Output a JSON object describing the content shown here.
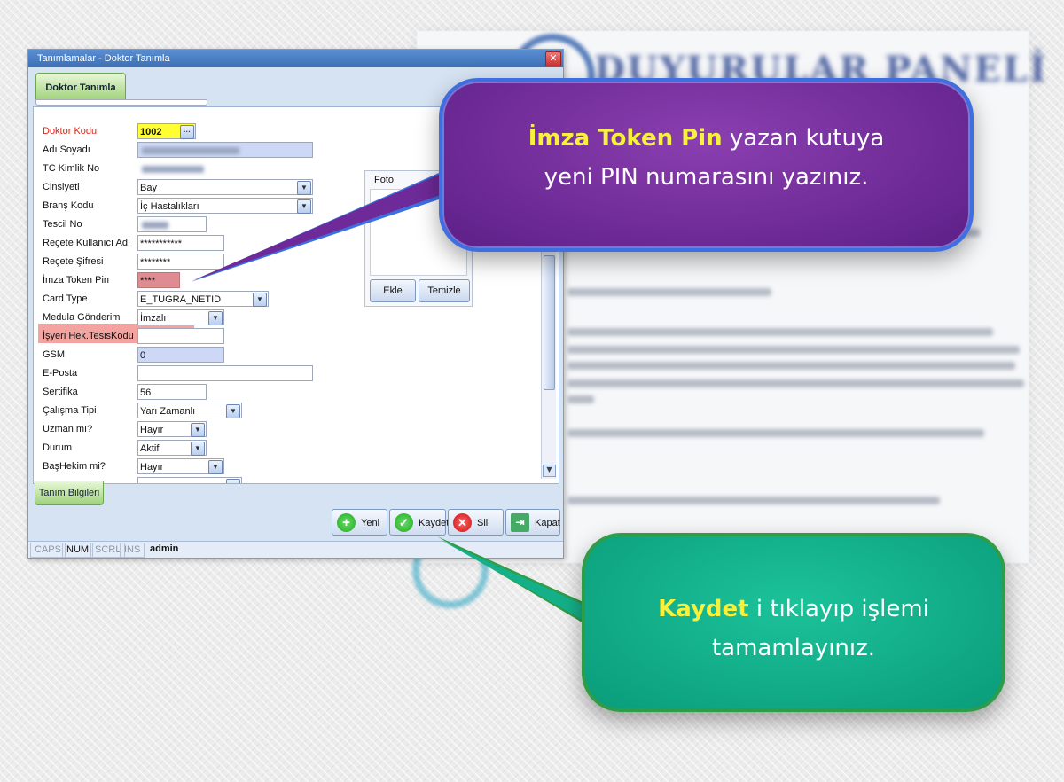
{
  "window": {
    "title": "Tanımlamalar - Doktor Tanımla",
    "close_glyph": "✕",
    "tab_label": "Doktor Tanımla",
    "bottom_tab_label": "Tanım Bilgileri"
  },
  "form": {
    "fields": [
      {
        "label": "Doktor Kodu",
        "value": "1002"
      },
      {
        "label": "Adı Soyadı",
        "value": ""
      },
      {
        "label": "TC Kimlik No",
        "value": ""
      },
      {
        "label": "Cinsiyeti",
        "value": "Bay"
      },
      {
        "label": "Branş Kodu",
        "value": "İç Hastalıkları"
      },
      {
        "label": "Tescil No",
        "value": ""
      },
      {
        "label": "Reçete Kullanıcı Adı",
        "value": "***********"
      },
      {
        "label": "Reçete Şifresi",
        "value": "********"
      },
      {
        "label": "İmza Token Pin",
        "value": "****"
      },
      {
        "label": "Card Type",
        "value": "E_TUGRA_NETID"
      },
      {
        "label": "Medula Gönderim",
        "value": "İmzalı"
      },
      {
        "label": "İşyeri Hek.TesisKodu",
        "value": ""
      },
      {
        "label": "GSM",
        "value": "0"
      },
      {
        "label": "E-Posta",
        "value": ""
      },
      {
        "label": "Sertifika",
        "value": "56"
      },
      {
        "label": "Çalışma Tipi",
        "value": "Yarı Zamanlı"
      },
      {
        "label": "Uzman mı?",
        "value": "Hayır"
      },
      {
        "label": "Durum",
        "value": "Aktif"
      },
      {
        "label": "BaşHekim mi?",
        "value": "Hayır"
      }
    ]
  },
  "foto": {
    "label": "Foto",
    "add_label": "Ekle",
    "clear_label": "Temizle"
  },
  "buttons": {
    "new": "Yeni",
    "save": "Kaydet",
    "delete": "Sil",
    "close": "Kapat"
  },
  "statusbar": {
    "caps": "CAPS",
    "num": "NUM",
    "scrl": "SCRL",
    "ins": "INS",
    "user": "admin"
  },
  "callouts": {
    "pin": {
      "highlight": "İmza Token Pin",
      "line1_rest": " yazan kutuya",
      "line2": "yeni PIN numarasını yazınız."
    },
    "save": {
      "highlight": "Kaydet",
      "line1_rest": " i tıklayıp işlemi",
      "line2": "tamamlayınız."
    }
  },
  "background_title": "DUYURULAR PANELİ"
}
